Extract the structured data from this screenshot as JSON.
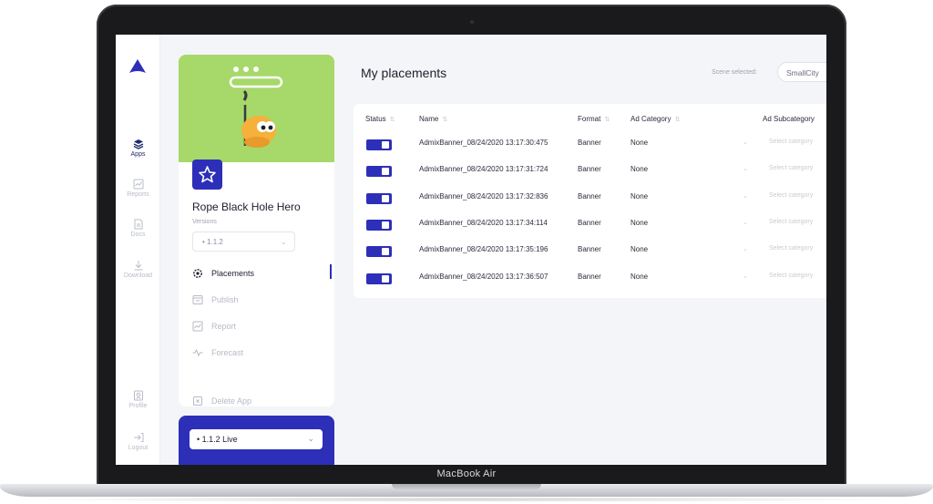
{
  "device": {
    "label": "MacBook Air"
  },
  "rail": {
    "items": [
      {
        "label": "Apps"
      },
      {
        "label": "Reports"
      },
      {
        "label": "Docs"
      },
      {
        "label": "Download"
      },
      {
        "label": "Profile"
      },
      {
        "label": "Logout"
      }
    ]
  },
  "app": {
    "name": "Rope Black Hole Hero",
    "versions_label": "Versions",
    "version_selected": "• 1.1.2",
    "menu": [
      {
        "label": "Placements"
      },
      {
        "label": "Publish"
      },
      {
        "label": "Report"
      },
      {
        "label": "Forecast"
      }
    ],
    "delete_label": "Delete App",
    "live_version": "• 1.1.2 Live"
  },
  "main": {
    "title": "My placements",
    "scene_label": "Scene selected:",
    "scene_value": "SmallCity"
  },
  "table": {
    "headers": {
      "status": "Status",
      "name": "Name",
      "format": "Format",
      "ad_category": "Ad Category",
      "ad_subcategory": "Ad Subcategory"
    },
    "rows": [
      {
        "name": "AdmixBanner_08/24/2020 13:17:30:475",
        "format": "Banner",
        "category": "None",
        "subcategory": "Select category"
      },
      {
        "name": "AdmixBanner_08/24/2020 13:17:31:724",
        "format": "Banner",
        "category": "None",
        "subcategory": "Select category"
      },
      {
        "name": "AdmixBanner_08/24/2020 13:17:32:836",
        "format": "Banner",
        "category": "None",
        "subcategory": "Select category"
      },
      {
        "name": "AdmixBanner_08/24/2020 13:17:34:114",
        "format": "Banner",
        "category": "None",
        "subcategory": "Select category"
      },
      {
        "name": "AdmixBanner_08/24/2020 13:17:35:196",
        "format": "Banner",
        "category": "None",
        "subcategory": "Select category"
      },
      {
        "name": "AdmixBanner_08/24/2020 13:17:36:507",
        "format": "Banner",
        "category": "None",
        "subcategory": "Select category"
      }
    ]
  },
  "colors": {
    "accent": "#2d2fb8",
    "hero": "#a7d86a"
  }
}
